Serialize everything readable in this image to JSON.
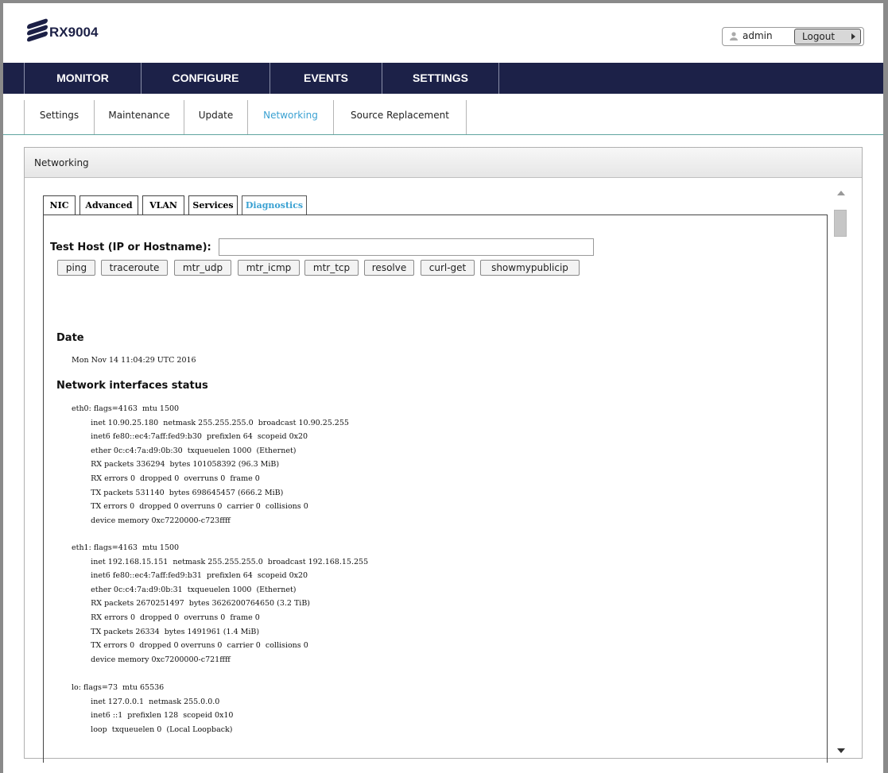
{
  "header": {
    "product": "RX9004",
    "user": "admin",
    "logout_label": "Logout"
  },
  "nav": {
    "items": [
      "MONITOR",
      "CONFIGURE",
      "EVENTS",
      "SETTINGS"
    ]
  },
  "subnav": {
    "items": [
      "Settings",
      "Maintenance",
      "Update",
      "Networking",
      "Source Replacement"
    ],
    "active": "Networking"
  },
  "panel": {
    "title": "Networking"
  },
  "tabs": {
    "items": [
      "NIC",
      "Advanced",
      "VLAN",
      "Services",
      "Diagnostics"
    ],
    "active": "Diagnostics"
  },
  "diagnostics": {
    "host_label": "Test Host (IP or Hostname):",
    "host_value": "",
    "buttons": [
      "ping",
      "traceroute",
      "mtr_udp",
      "mtr_icmp",
      "mtr_tcp",
      "resolve",
      "curl-get",
      "showmypublicip"
    ]
  },
  "output": {
    "date_title": "Date",
    "date_value": "Mon Nov 14 11:04:29 UTC 2016",
    "net_title": "Network interfaces status",
    "eth0": "eth0: flags=4163  mtu 1500\n        inet 10.90.25.180  netmask 255.255.255.0  broadcast 10.90.25.255\n        inet6 fe80::ec4:7aff:fed9:b30  prefixlen 64  scopeid 0x20\n        ether 0c:c4:7a:d9:0b:30  txqueuelen 1000  (Ethernet)\n        RX packets 336294  bytes 101058392 (96.3 MiB)\n        RX errors 0  dropped 0  overruns 0  frame 0\n        TX packets 531140  bytes 698645457 (666.2 MiB)\n        TX errors 0  dropped 0 overruns 0  carrier 0  collisions 0\n        device memory 0xc7220000-c723ffff",
    "eth1": "eth1: flags=4163  mtu 1500\n        inet 192.168.15.151  netmask 255.255.255.0  broadcast 192.168.15.255\n        inet6 fe80::ec4:7aff:fed9:b31  prefixlen 64  scopeid 0x20\n        ether 0c:c4:7a:d9:0b:31  txqueuelen 1000  (Ethernet)\n        RX packets 2670251497  bytes 3626200764650 (3.2 TiB)\n        RX errors 0  dropped 0  overruns 0  frame 0\n        TX packets 26334  bytes 1491961 (1.4 MiB)\n        TX errors 0  dropped 0 overruns 0  carrier 0  collisions 0\n        device memory 0xc7200000-c721ffff",
    "lo": "lo: flags=73  mtu 65536\n        inet 127.0.0.1  netmask 255.0.0.0\n        inet6 ::1  prefixlen 128  scopeid 0x10\n        loop  txqueuelen 0  (Local Loopback)"
  }
}
